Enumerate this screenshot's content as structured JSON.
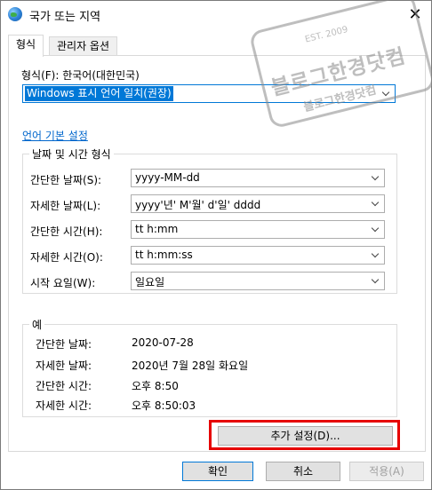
{
  "window": {
    "title": "국가 또는 지역",
    "close_glyph": "✕"
  },
  "tabs": [
    {
      "label": "형식"
    },
    {
      "label": "관리자 옵션"
    }
  ],
  "format": {
    "label": "형식(F): 한국어(대한민국)",
    "selected": "Windows 표시 언어 일치(권장)"
  },
  "language_link": "언어 기본 설정",
  "date_time": {
    "group_title": "날짜 및 시간 형식",
    "rows": [
      {
        "label": "간단한 날짜(S):",
        "value": "yyyy-MM-dd"
      },
      {
        "label": "자세한 날짜(L):",
        "value": "yyyy'년' M'월' d'일' dddd"
      },
      {
        "label": "간단한 시간(H):",
        "value": "tt h:mm"
      },
      {
        "label": "자세한 시간(O):",
        "value": "tt h:mm:ss"
      },
      {
        "label": "시작 요일(W):",
        "value": "일요일"
      }
    ]
  },
  "examples": {
    "group_title": "예",
    "rows": [
      {
        "label": "간단한 날짜:",
        "value": "2020-07-28"
      },
      {
        "label": "자세한 날짜:",
        "value": "2020년 7월 28일 화요일"
      },
      {
        "label": "간단한 시간:",
        "value": "오후 8:50"
      },
      {
        "label": "자세한 시간:",
        "value": "오후 8:50:03"
      }
    ]
  },
  "buttons": {
    "additional_settings": "추가 설정(D)...",
    "ok": "확인",
    "cancel": "취소",
    "apply": "적용(A)"
  },
  "watermark": {
    "main": "블로그한경닷컴",
    "top": "EST. 2009",
    "bottom": "블로그한경닷컴"
  },
  "colors": {
    "accent": "#0078d7",
    "link": "#0066cc",
    "highlight": "#e60000"
  }
}
